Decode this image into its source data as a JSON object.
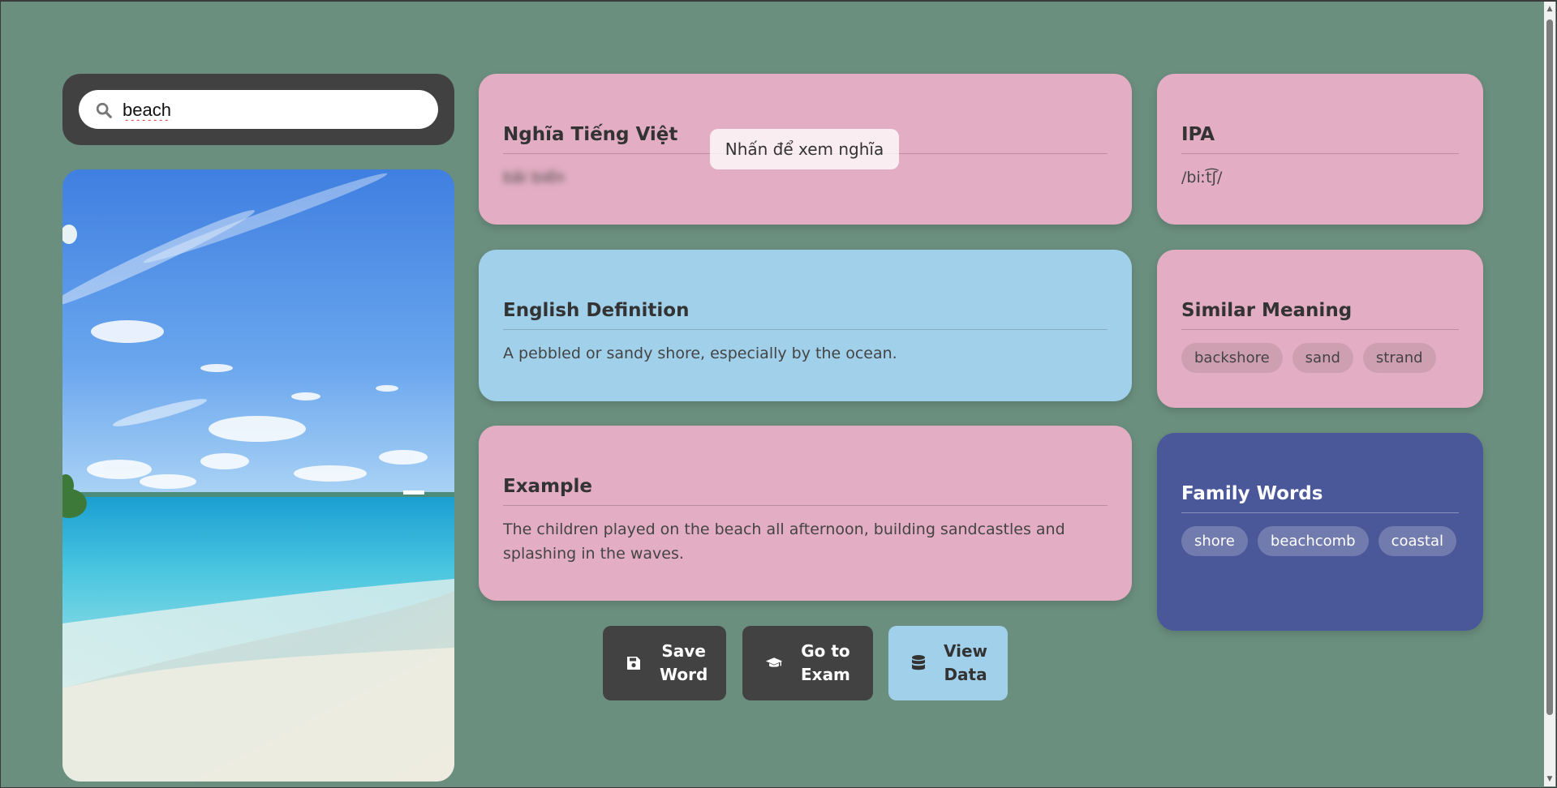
{
  "search": {
    "value": "beach"
  },
  "vietnamese": {
    "title": "Nghĩa Tiếng Việt",
    "meaning": "bãi biển",
    "reveal_hint": "Nhấn để xem nghĩa"
  },
  "ipa": {
    "title": "IPA",
    "value": "/biːt͡ʃ/"
  },
  "definition": {
    "title": "English Definition",
    "text": "A pebbled or sandy shore, especially by the ocean."
  },
  "similar": {
    "title": "Similar Meaning",
    "tags": [
      "backshore",
      "sand",
      "strand"
    ]
  },
  "example": {
    "title": "Example",
    "text": "The children played on the beach all afternoon, building sandcastles and splashing in the waves."
  },
  "family": {
    "title": "Family Words",
    "tags": [
      "shore",
      "beachcomb",
      "coastal"
    ]
  },
  "buttons": {
    "save": {
      "line1": "Save",
      "line2": "Word"
    },
    "exam": {
      "line1": "Go to",
      "line2": "Exam"
    },
    "view": {
      "line1": "View",
      "line2": "Data"
    }
  },
  "colors": {
    "background": "#6b8f7f",
    "pink_card": "#e3aec3",
    "blue_card": "#a1d1ea",
    "navy_card": "#4a5798",
    "dark_button": "#424242"
  },
  "icons": [
    "search-icon",
    "save-icon",
    "graduation-cap-icon",
    "database-icon"
  ]
}
